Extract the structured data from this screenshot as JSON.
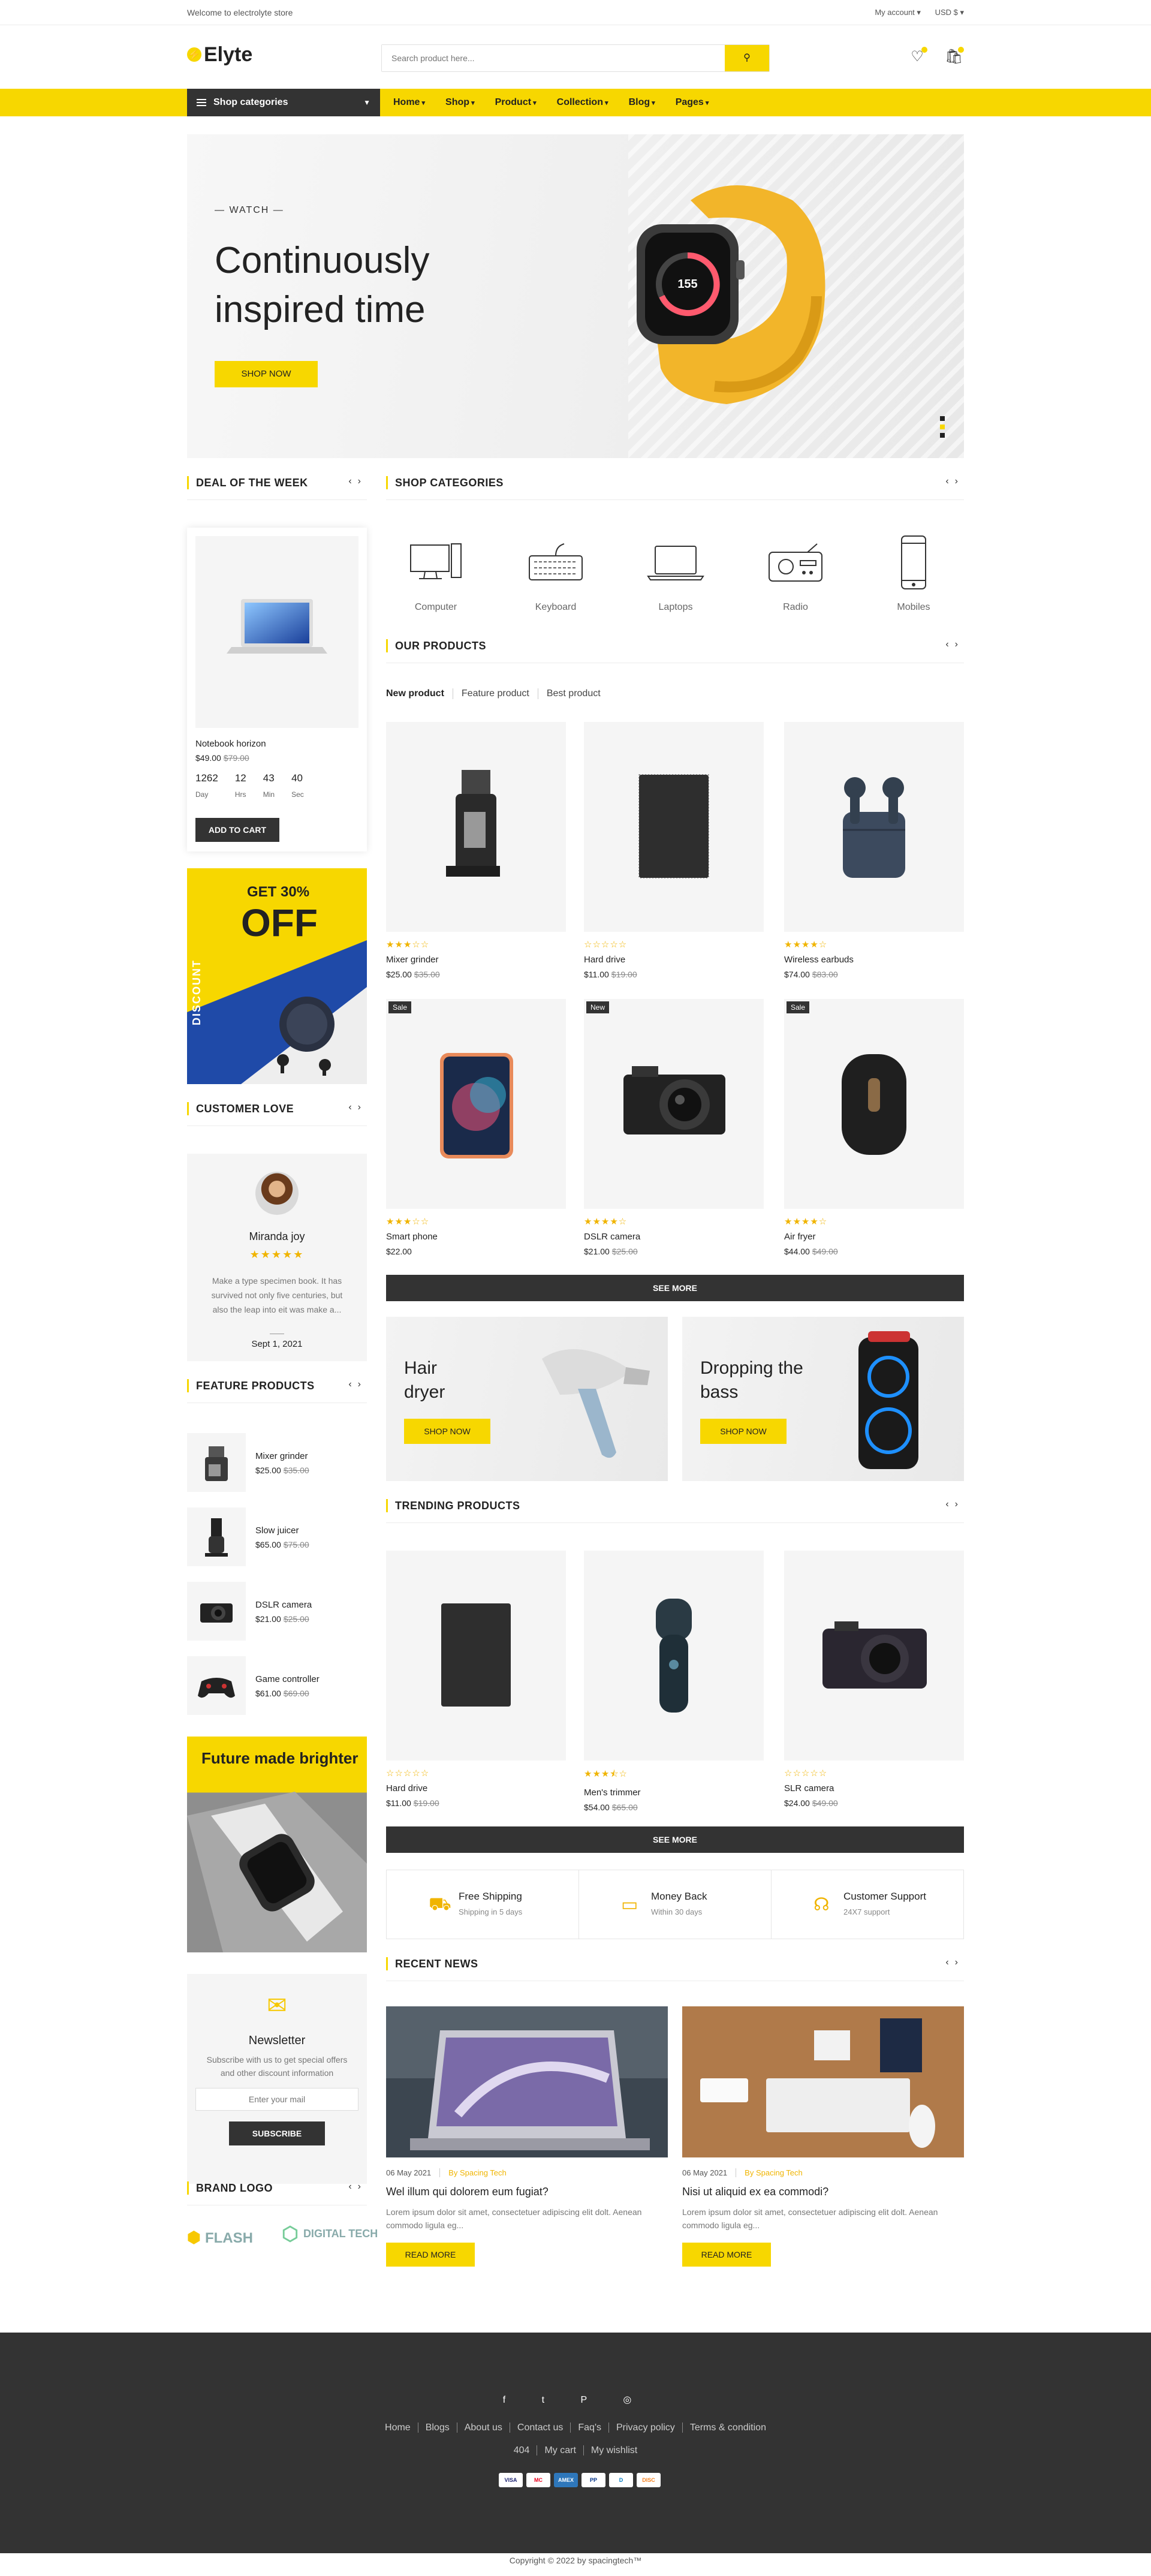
{
  "topbar": {
    "welcome": "Welcome to electrolyte store",
    "account": "My account ▾",
    "currency": "USD $ ▾"
  },
  "header": {
    "logo": "Elyte",
    "search_placeholder": "Search product here...",
    "cart_icon": "bag-icon",
    "wishlist_icon": "heart-icon"
  },
  "nav": {
    "categories": "Shop categories",
    "items": [
      "Home",
      "Shop",
      "Product",
      "Collection",
      "Blog",
      "Pages"
    ]
  },
  "hero": {
    "tag": "— WATCH —",
    "title": "Continuously inspired time",
    "button": "SHOP NOW",
    "watch_time": "155"
  },
  "deal": {
    "heading": "DEAL OF THE WEEK",
    "name": "Notebook horizon",
    "price": "$49.00",
    "old": "$79.00",
    "timer": [
      {
        "v": "1262",
        "l": "Day"
      },
      {
        "v": "12",
        "l": "Hrs"
      },
      {
        "v": "43",
        "l": "Min"
      },
      {
        "v": "40",
        "l": "Sec"
      }
    ],
    "button": "ADD TO CART"
  },
  "side_banner": {
    "get": "GET 30%",
    "off": "OFF",
    "vertical": "DISCOUNT"
  },
  "customer": {
    "heading": "CUSTOMER LOVE",
    "name": "Miranda joy",
    "stars": "★★★★★",
    "text": "Make a type specimen book. It has survived not only five centuries, but also the leap into eit was make a...",
    "date": "Sept 1, 2021"
  },
  "feature": {
    "heading": "FEATURE PRODUCTS",
    "items": [
      {
        "name": "Mixer grinder",
        "price": "$25.00",
        "old": "$35.00"
      },
      {
        "name": "Slow juicer",
        "price": "$65.00",
        "old": "$75.00"
      },
      {
        "name": "DSLR camera",
        "price": "$21.00",
        "old": "$25.00"
      },
      {
        "name": "Game controller",
        "price": "$61.00",
        "old": "$69.00"
      }
    ]
  },
  "future_banner": {
    "title": "Future made brighter"
  },
  "newsletter": {
    "title": "Newsletter",
    "desc": "Subscribe with us to get special offers and other discount information",
    "placeholder": "Enter your mail",
    "button": "SUBSCRIBE"
  },
  "brand": {
    "heading": "BRAND LOGO",
    "items": [
      "FLASH",
      "DIGITAL TECH"
    ]
  },
  "shop_categories": {
    "heading": "SHOP CATEGORIES",
    "items": [
      "Computer",
      "Keyboard",
      "Laptops",
      "Radio",
      "Mobiles"
    ]
  },
  "our_products": {
    "heading": "OUR PRODUCTS",
    "tabs": [
      "New product",
      "Feature product",
      "Best product"
    ],
    "items": [
      {
        "name": "Mixer grinder",
        "price": "$25.00",
        "old": "$35.00",
        "rating": 3,
        "badge": ""
      },
      {
        "name": "Hard drive",
        "price": "$11.00",
        "old": "$19.00",
        "rating": 0,
        "badge": ""
      },
      {
        "name": "Wireless earbuds",
        "price": "$74.00",
        "old": "$83.00",
        "rating": 4,
        "badge": ""
      },
      {
        "name": "Smart phone",
        "price": "$22.00",
        "old": "",
        "rating": 3,
        "badge": "Sale"
      },
      {
        "name": "DSLR camera",
        "price": "$21.00",
        "old": "$25.00",
        "rating": 4,
        "badge": "New"
      },
      {
        "name": "Air fryer",
        "price": "$44.00",
        "old": "$49.00",
        "rating": 4,
        "badge": "Sale"
      }
    ],
    "see_more": "SEE MORE"
  },
  "promos": [
    {
      "title": "Hair dryer",
      "button": "SHOP NOW"
    },
    {
      "title": "Dropping the bass",
      "button": "SHOP NOW"
    }
  ],
  "trending": {
    "heading": "TRENDING PRODUCTS",
    "items": [
      {
        "name": "Hard drive",
        "price": "$11.00",
        "old": "$19.00",
        "rating": 0
      },
      {
        "name": "Men's trimmer",
        "price": "$54.00",
        "old": "$65.00",
        "rating": 3.5
      },
      {
        "name": "SLR camera",
        "price": "$24.00",
        "old": "$49.00",
        "rating": 0
      }
    ],
    "see_more": "SEE MORE"
  },
  "services": [
    {
      "icon": "truck-icon",
      "title": "Free Shipping",
      "desc": "Shipping in 5 days"
    },
    {
      "icon": "wallet-icon",
      "title": "Money Back",
      "desc": "Within 30 days"
    },
    {
      "icon": "headset-icon",
      "title": "Customer Support",
      "desc": "24X7 support"
    }
  ],
  "news": {
    "heading": "RECENT NEWS",
    "posts": [
      {
        "date": "06 May 2021",
        "author": "By Spacing Tech",
        "title": "Wel illum qui dolorem eum fugiat?",
        "excerpt": "Lorem ipsum dolor sit amet, consectetuer adipiscing elit dolt. Aenean commodo ligula eg...",
        "button": "READ MORE"
      },
      {
        "date": "06 May 2021",
        "author": "By Spacing Tech",
        "title": "Nisi ut aliquid ex ea commodi?",
        "excerpt": "Lorem ipsum dolor sit amet, consectetuer adipiscing elit dolt. Aenean commodo ligula eg...",
        "button": "READ MORE"
      }
    ]
  },
  "footer": {
    "social": [
      "f",
      "t",
      "P",
      "◎"
    ],
    "links1": [
      "Home",
      "Blogs",
      "About us",
      "Contact us",
      "Faq's",
      "Privacy policy",
      "Terms & condition"
    ],
    "links2": [
      "404",
      "My cart",
      "My wishlist"
    ],
    "payments": [
      "VISA",
      "MC",
      "AMEX",
      "PP",
      "D",
      "DISC"
    ],
    "copyright": "Copyright © 2022 by spacingtech™"
  }
}
